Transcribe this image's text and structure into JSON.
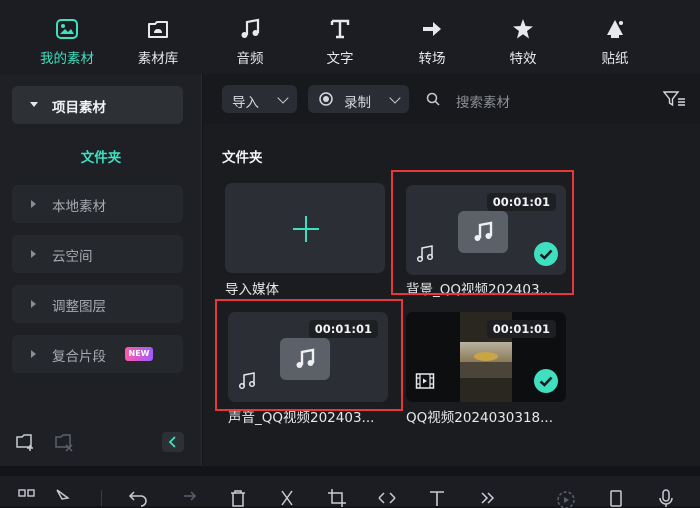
{
  "toolbar": {
    "tabs": [
      {
        "label": "我的素材",
        "icon": "my-media-icon",
        "active": true
      },
      {
        "label": "素材库",
        "icon": "stock-media-icon"
      },
      {
        "label": "音频",
        "icon": "music-note-icon"
      },
      {
        "label": "文字",
        "icon": "text-icon"
      },
      {
        "label": "转场",
        "icon": "transition-icon"
      },
      {
        "label": "特效",
        "icon": "effects-icon"
      },
      {
        "label": "贴纸",
        "icon": "sticker-icon"
      }
    ]
  },
  "sidebar": {
    "header": "项目素材",
    "folder_label": "文件夹",
    "items": [
      {
        "label": "本地素材"
      },
      {
        "label": "云空间"
      },
      {
        "label": "调整图层"
      },
      {
        "label": "复合片段",
        "badge": "NEW"
      }
    ]
  },
  "filters": {
    "import_label": "导入",
    "record_label": "录制",
    "search_placeholder": "搜索素材"
  },
  "main": {
    "section_title": "文件夹",
    "import_card_label": "导入媒体",
    "media": [
      {
        "name": "背景_QQ视频202403...",
        "duration": "00:01:01",
        "kind": "audio",
        "checked": true,
        "highlighted": true
      },
      {
        "name": "声音_QQ视频202403...",
        "duration": "00:01:01",
        "kind": "audio",
        "checked": false,
        "highlighted": true
      },
      {
        "name": "QQ视频2024030318...",
        "duration": "00:01:01",
        "kind": "video",
        "checked": true,
        "highlighted": false
      }
    ]
  },
  "colors": {
    "accent": "#3fe0bf",
    "highlight_box": "#e8363b",
    "new_badge": "#ff5aa6"
  }
}
